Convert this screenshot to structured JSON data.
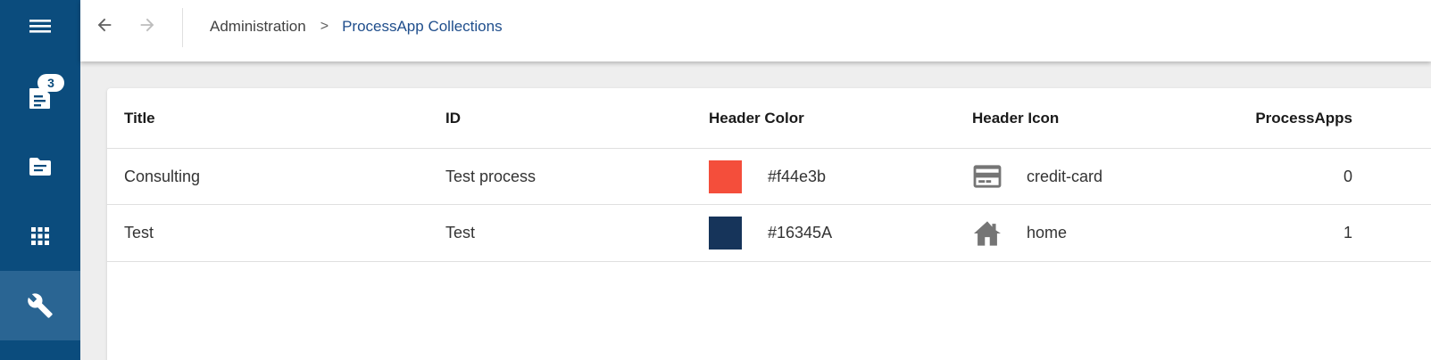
{
  "sidebar": {
    "items": [
      {
        "name": "menu",
        "icon": "menu-icon"
      },
      {
        "name": "tasks",
        "icon": "tasks-icon",
        "badge": "3"
      },
      {
        "name": "documents",
        "icon": "folder-icon"
      },
      {
        "name": "apps",
        "icon": "apps-grid-icon"
      },
      {
        "name": "administration",
        "icon": "wrench-icon",
        "active": true
      }
    ],
    "background": "#0b4c7d",
    "active_background": "#2a6593"
  },
  "topbar": {
    "back_icon": "arrow-back-icon",
    "forward_icon": "arrow-forward-icon",
    "breadcrumb": {
      "parent": "Administration",
      "separator": ">",
      "current": "ProcessApp Collections"
    }
  },
  "table": {
    "columns": [
      "Title",
      "ID",
      "Header Color",
      "Header Icon",
      "ProcessApps"
    ],
    "rows": [
      {
        "title": "Consulting",
        "id": "Test process",
        "color": "#f44e3b",
        "color_label": "#f44e3b",
        "icon": "credit-card",
        "process_apps": "0"
      },
      {
        "title": "Test",
        "id": "Test",
        "color": "#16345A",
        "color_label": "#16345A",
        "icon": "home",
        "process_apps": "1"
      }
    ]
  }
}
